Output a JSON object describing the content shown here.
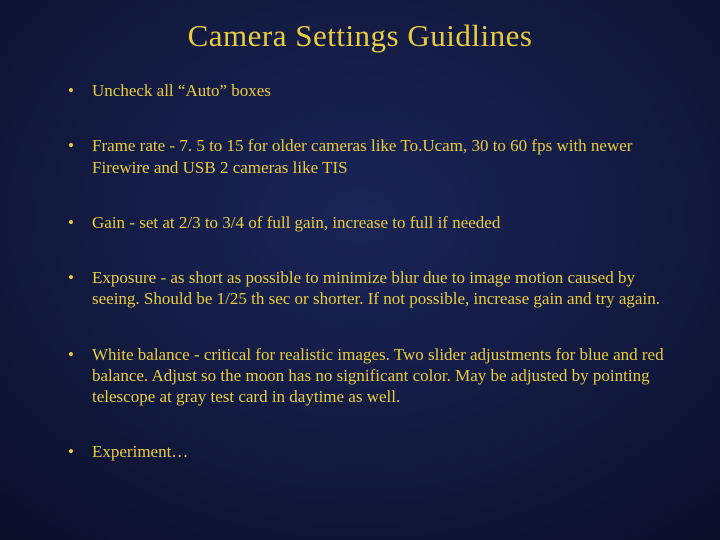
{
  "title": "Camera Settings Guidlines",
  "bullets": [
    "Uncheck all “Auto” boxes",
    "Frame rate - 7. 5 to 15 for older cameras like To.Ucam, 30 to 60 fps with newer Firewire and USB 2 cameras like TIS",
    "Gain - set at 2/3 to 3/4 of full gain, increase to full if needed",
    "Exposure - as short as possible to minimize blur due to image motion caused by seeing.  Should be 1/25 th sec or shorter.  If not possible, increase gain and try again.",
    "White balance - critical for realistic images.  Two slider adjustments for blue and red balance.  Adjust so the moon has no significant color.  May be adjusted by pointing telescope at gray test card in daytime as well.",
    "Experiment…"
  ]
}
